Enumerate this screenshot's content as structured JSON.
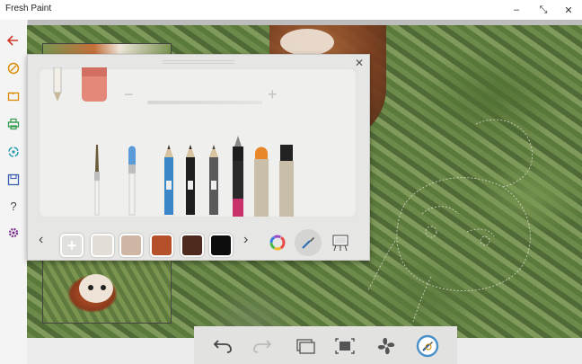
{
  "window": {
    "title": "Fresh Paint",
    "minimize_glyph": "–",
    "restore_glyph": "⤡",
    "close_glyph": "✕"
  },
  "sidebar": {
    "items": [
      {
        "name": "back",
        "icon": "arrow-left-icon"
      },
      {
        "name": "paint",
        "icon": "brush-circle-icon"
      },
      {
        "name": "open",
        "icon": "folder-icon"
      },
      {
        "name": "print",
        "icon": "printer-icon"
      },
      {
        "name": "share",
        "icon": "share-icon"
      },
      {
        "name": "save",
        "icon": "save-icon"
      },
      {
        "name": "help",
        "icon": "question-icon",
        "glyph": "?"
      },
      {
        "name": "settings",
        "icon": "gear-icon"
      }
    ]
  },
  "tool_panel": {
    "close_glyph": "✕",
    "size_minus": "−",
    "size_plus": "+",
    "tools": [
      "pencil",
      "eraser",
      "fine-brush",
      "wide-brush",
      "pencil-blue",
      "pencil-black",
      "pencil-gray",
      "pen",
      "marker-orange",
      "marker-black"
    ],
    "nav_prev": "‹",
    "nav_next": "›",
    "add_color": "+",
    "swatches": [
      "#e2ddd6",
      "#cfb6a4",
      "#b4502a",
      "#4e2a1e",
      "#0d0d0d"
    ]
  },
  "colors": {
    "accent_blue": "#4a90c8",
    "sidebar_icon": "#d98a00",
    "back_red": "#d13a2a",
    "settings_purple": "#7a2a8a"
  },
  "bottom_toolbar": {
    "items": [
      "undo-icon",
      "redo-icon",
      "layers-icon",
      "fit-screen-icon",
      "fan-icon",
      "color-picker-icon"
    ]
  }
}
